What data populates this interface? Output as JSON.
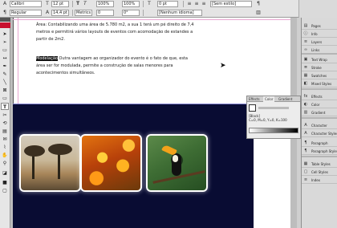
{
  "control_panel": {
    "font_family": "Calibri",
    "font_style": "Regular",
    "font_size": "12 pt",
    "leading": "14,4 pt",
    "tracking": "0",
    "kerning": "Metrics",
    "scale_v": "100%",
    "scale_h": "100%",
    "baseline": "0 pt",
    "skew": "0°",
    "language": "[Nenhum idioma]",
    "style": "[Sem estilo]",
    "type_bold": "T",
    "type_italic": "T"
  },
  "text_frame": {
    "paragraph1": "Área: Contabilizando uma área de 5.780 m2, a sua 1 terá um pé direito de 7,4 metros e permitirá vários layouts de eventos com acomodação de estandes a partir de 2m2.",
    "highlighted_word": "Modelação",
    "paragraph2": " Outra vantagem ao organizador do evento é o fato de que, esta área ser for modulada, permite a construção de salas menores para acontecimentos simultâneos."
  },
  "swatches_panel": {
    "tabs": [
      "Effects",
      "Color",
      "Gradient"
    ],
    "active_tab": "Color",
    "swatch_name": "[Black]",
    "swatch_detail": "C=0, M=0, Y=0, K=100"
  },
  "right_panel": {
    "items": [
      {
        "label": "Pages",
        "icon": "pages-icon",
        "glyph": "▤"
      },
      {
        "label": "Info",
        "icon": "info-icon",
        "glyph": "ⓘ"
      },
      {
        "label": "Layers",
        "icon": "layers-icon",
        "glyph": "≡"
      },
      {
        "label": "Links",
        "icon": "links-icon",
        "glyph": "∞"
      },
      {
        "label": "Text Wrap",
        "icon": "text-wrap-icon",
        "glyph": "▣"
      },
      {
        "label": "Stroke",
        "icon": "stroke-icon",
        "glyph": "≣"
      },
      {
        "label": "Swatches",
        "icon": "swatches-icon",
        "glyph": "▦"
      },
      {
        "label": "Mixed Styles",
        "icon": "mixed-styles-icon",
        "glyph": "◧"
      },
      {
        "label": "Effects",
        "icon": "effects-icon",
        "glyph": "fx"
      },
      {
        "label": "Color",
        "icon": "color-icon",
        "glyph": "◐"
      },
      {
        "label": "Gradient",
        "icon": "gradient-icon",
        "glyph": "▥"
      },
      {
        "label": "Character",
        "icon": "character-icon",
        "glyph": "A"
      },
      {
        "label": "Character Styles",
        "icon": "character-styles-icon",
        "glyph": "A"
      },
      {
        "label": "Paragraph",
        "icon": "paragraph-icon",
        "glyph": "¶"
      },
      {
        "label": "Paragraph Styles",
        "icon": "paragraph-styles-icon",
        "glyph": "¶"
      },
      {
        "label": "Table Styles",
        "icon": "table-styles-icon",
        "glyph": "▦"
      },
      {
        "label": "Cell Styles",
        "icon": "cell-styles-icon",
        "glyph": "▢"
      },
      {
        "label": "Index",
        "icon": "index-icon",
        "glyph": "≡"
      }
    ]
  },
  "colors": {
    "banner": "#090c33",
    "highlight": "#111111",
    "margin_guide": "#e7a6d1"
  }
}
